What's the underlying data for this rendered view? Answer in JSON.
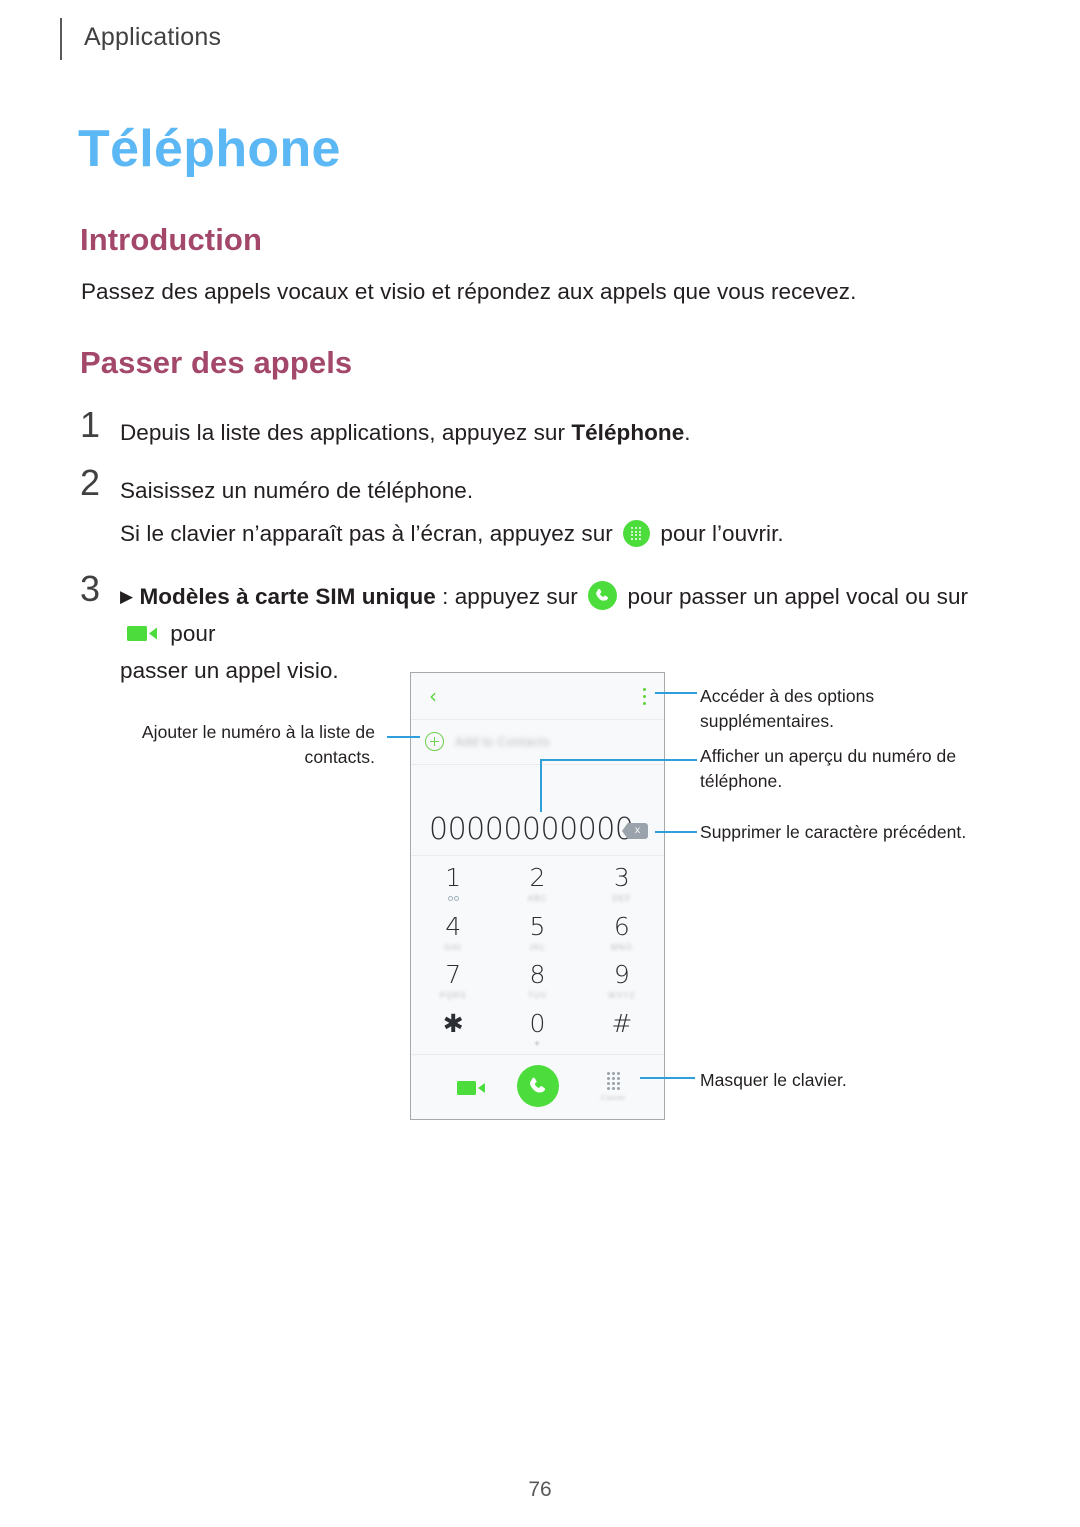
{
  "header": {
    "label": "Applications"
  },
  "chapter": {
    "title": "Téléphone"
  },
  "sections": {
    "introduction": {
      "heading": "Introduction",
      "body": "Passez des appels vocaux et visio et répondez aux appels que vous recevez."
    },
    "passer_des_appels": {
      "heading": "Passer des appels"
    }
  },
  "steps": [
    {
      "number": "1",
      "text_before": "Depuis la liste des applications, appuyez sur ",
      "bold": "Téléphone",
      "text_after": "."
    },
    {
      "number": "2",
      "text": "Saisissez un numéro de téléphone.",
      "sub_before": "Si le clavier n’apparaît pas à l’écran, appuyez sur ",
      "sub_icon": "keypad-green-icon",
      "sub_after": " pour l’ouvrir."
    },
    {
      "number": "3",
      "marker": "▶",
      "bold": "Modèles à carte SIM unique",
      "text_mid1": " : appuyez sur ",
      "icon1": "call-green-icon",
      "text_mid2": " pour passer un appel vocal ou sur ",
      "icon2": "video-green-icon",
      "text_mid3": " pour",
      "text_line2": "passer un appel visio."
    }
  ],
  "phone_mockup": {
    "back_icon": "chevron-left-icon",
    "menu_icon": "kebab-menu-icon",
    "add_contact_icon": "plus-circle-icon",
    "add_contact_label": "Add to Contacts",
    "number_display": "00000000000",
    "backspace_icon": "backspace-icon",
    "backspace_glyph": "x",
    "dialpad_keys": [
      {
        "digit": "1",
        "sub": "",
        "sub_type": "voicemail"
      },
      {
        "digit": "2",
        "sub": "ABC",
        "sub_type": "letters"
      },
      {
        "digit": "3",
        "sub": "DEF",
        "sub_type": "letters"
      },
      {
        "digit": "4",
        "sub": "GHI",
        "sub_type": "letters"
      },
      {
        "digit": "5",
        "sub": "JKL",
        "sub_type": "letters"
      },
      {
        "digit": "6",
        "sub": "MNO",
        "sub_type": "letters"
      },
      {
        "digit": "7",
        "sub": "PQRS",
        "sub_type": "letters"
      },
      {
        "digit": "8",
        "sub": "TUV",
        "sub_type": "letters"
      },
      {
        "digit": "9",
        "sub": "WXYZ",
        "sub_type": "letters"
      },
      {
        "digit": "✱",
        "sub": "",
        "sub_type": "none"
      },
      {
        "digit": "0",
        "sub": "+",
        "sub_type": "plus"
      },
      {
        "digit": "#",
        "sub": "",
        "sub_type": "none"
      }
    ],
    "action_bar": {
      "video_icon": "video-call-icon",
      "call_icon": "call-icon",
      "keypad_icon": "keypad-icon",
      "keypad_label": "Clavier"
    }
  },
  "callouts": {
    "add_to_contacts": "Ajouter le numéro à la liste de contacts.",
    "more_options": "Accéder à des options supplémentaires.",
    "preview_number": "Afficher un aperçu du numéro de téléphone.",
    "delete_char": "Supprimer le caractère précédent.",
    "hide_keypad": "Masquer le clavier."
  },
  "footer": {
    "page_number": "76"
  },
  "colors": {
    "chapter_title": "#5cb7f5",
    "heading": "#a3476b",
    "accent_green": "#4cdd3c",
    "connector_blue": "#2e9fda"
  }
}
